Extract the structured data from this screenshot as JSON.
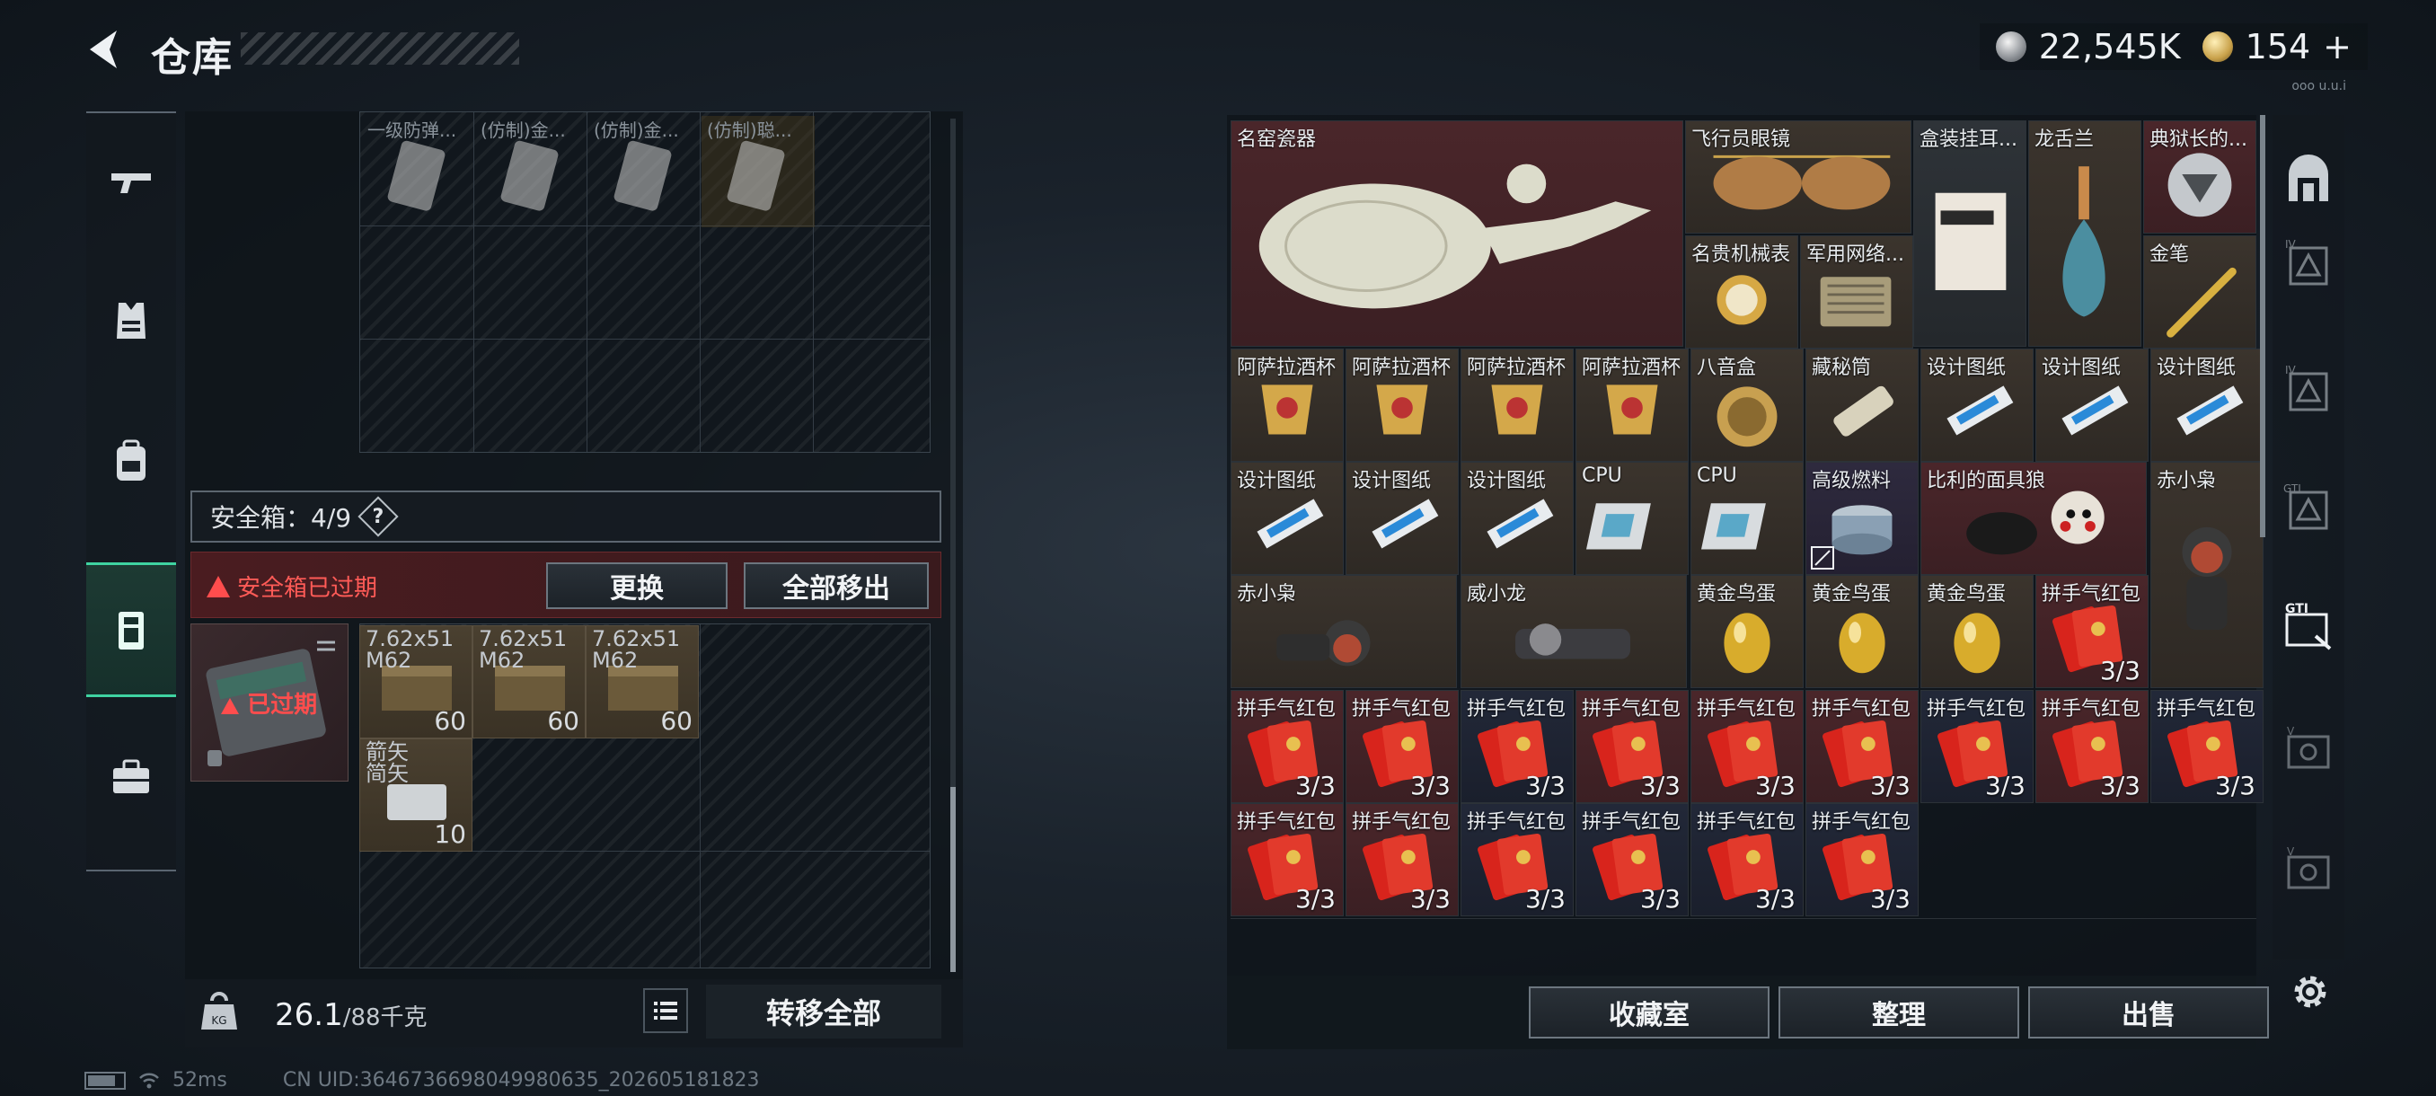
{
  "header": {
    "title": "仓库"
  },
  "currency": {
    "silver_amount": "22,545K",
    "gold_amount": "154",
    "gold_plus": "+",
    "version_tag": "ooo u.u.i"
  },
  "left_nav": {
    "icons": [
      "pistol-icon",
      "vest-icon",
      "backpack-icon",
      "safe-box-icon",
      "toolbox-icon"
    ],
    "active_index": 3
  },
  "bag": {
    "top_items": [
      "一级防弹...",
      "(仿制)金...",
      "(仿制)金...",
      "(仿制)聪..."
    ],
    "safe_header_label": "安全箱：4/9",
    "help_mark": "?",
    "warning": "安全箱已过期",
    "replace_button": "更换",
    "remove_all_button": "全部移出",
    "safe_status": "已过期",
    "ammo": [
      {
        "label": "7.62x51\nM62",
        "count": "60"
      },
      {
        "label": "7.62x51\nM62",
        "count": "60"
      },
      {
        "label": "7.62x51\nM62",
        "count": "60"
      },
      {
        "label": "箭矢\n简矢",
        "count": "10"
      }
    ],
    "weight_current": "26.1",
    "weight_max": "/88千克",
    "transfer_all_button": "转移全部"
  },
  "warehouse": {
    "items": {
      "vase": "名窑瓷器",
      "aviator_glasses": "飞行员眼镜",
      "boxed_earring": "盒装挂耳...",
      "gentian": "龙舌兰",
      "warden_badge": "典狱长的...",
      "luxury_watch": "名贵机械表",
      "military_router": "军用网络...",
      "gold_pen": "金笔",
      "asala_cup": "阿萨拉酒杯",
      "music_box": "八音盒",
      "hidden_tube": "藏秘筒",
      "blueprint": "设计图纸",
      "cpu": "CPU",
      "fuel": "高级燃料",
      "billy_mask": "比利的面具狼",
      "red_owl": "赤小枭",
      "weixiaolong": "威小龙",
      "golden_egg": "黄金鸟蛋",
      "red_packet": "拼手气红包",
      "packet_count": "3/3"
    },
    "collection_button": "收藏室",
    "sort_button": "整理",
    "sell_button": "出售"
  },
  "right_nav": {
    "icons": [
      "top-category-icon",
      "tier-iv-safe-icon",
      "tier-iv-safe-icon-2",
      "gti-safe-icon",
      "gti-ticket-icon",
      "tier-v-safe-icon",
      "tier-v-safe-icon-2"
    ],
    "tags": [
      "",
      "IV",
      "IV",
      "GTI",
      "GTI",
      "V",
      "V"
    ]
  },
  "status": {
    "ping": "52ms",
    "uid": "CN UID:3646736698049980635_202605181823"
  },
  "colors": {
    "accent_green": "#3fd3a1",
    "warning_red": "#ff4d4d"
  }
}
